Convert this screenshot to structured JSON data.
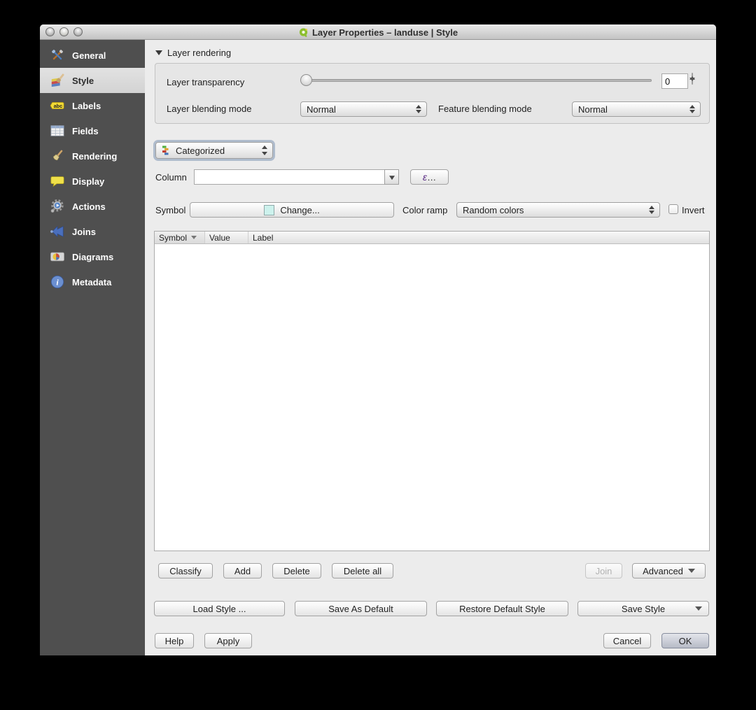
{
  "window": {
    "title": "Layer Properties – landuse | Style",
    "app_icon": "qgis-icon"
  },
  "sidebar": {
    "items": [
      {
        "label": "General",
        "icon": "tools-icon",
        "selected": false
      },
      {
        "label": "Style",
        "icon": "paint-style-icon",
        "selected": true
      },
      {
        "label": "Labels",
        "icon": "abc-tag-icon",
        "selected": false,
        "icon_text": "abc"
      },
      {
        "label": "Fields",
        "icon": "table-icon",
        "selected": false
      },
      {
        "label": "Rendering",
        "icon": "brush-icon",
        "selected": false
      },
      {
        "label": "Display",
        "icon": "speech-bubble-icon",
        "selected": false
      },
      {
        "label": "Actions",
        "icon": "gear-play-icon",
        "selected": false
      },
      {
        "label": "Joins",
        "icon": "join-arrow-icon",
        "selected": false
      },
      {
        "label": "Diagrams",
        "icon": "pie-map-icon",
        "selected": false
      },
      {
        "label": "Metadata",
        "icon": "info-icon",
        "selected": false,
        "icon_text": "i"
      }
    ]
  },
  "layer_rendering": {
    "header": "Layer rendering",
    "transparency_label": "Layer transparency",
    "transparency_value": "0",
    "transparency_slider_percent": 0,
    "layer_blending_label": "Layer blending mode",
    "layer_blending_value": "Normal",
    "feature_blending_label": "Feature blending mode",
    "feature_blending_value": "Normal"
  },
  "renderer": {
    "selected": "Categorized"
  },
  "column_row": {
    "label": "Column",
    "value": "",
    "expression_button": "…"
  },
  "symbol_row": {
    "label": "Symbol",
    "change_label": "Change...",
    "swatch_color": "#cdf2ed",
    "color_ramp_label": "Color ramp",
    "color_ramp_value": "Random colors",
    "invert_label": "Invert",
    "invert_checked": false
  },
  "categories_table": {
    "columns": [
      "Symbol",
      "Value",
      "Label"
    ],
    "sorted_column": "Symbol",
    "sort_direction": "descending",
    "rows": []
  },
  "classify_actions": {
    "classify": "Classify",
    "add": "Add",
    "delete": "Delete",
    "delete_all": "Delete all",
    "join": "Join",
    "join_enabled": false,
    "advanced": "Advanced"
  },
  "style_actions": {
    "load_style": "Load Style ...",
    "save_as_default": "Save As Default",
    "restore_default": "Restore Default Style",
    "save_style": "Save Style"
  },
  "dialog_actions": {
    "help": "Help",
    "apply": "Apply",
    "cancel": "Cancel",
    "ok": "OK"
  }
}
